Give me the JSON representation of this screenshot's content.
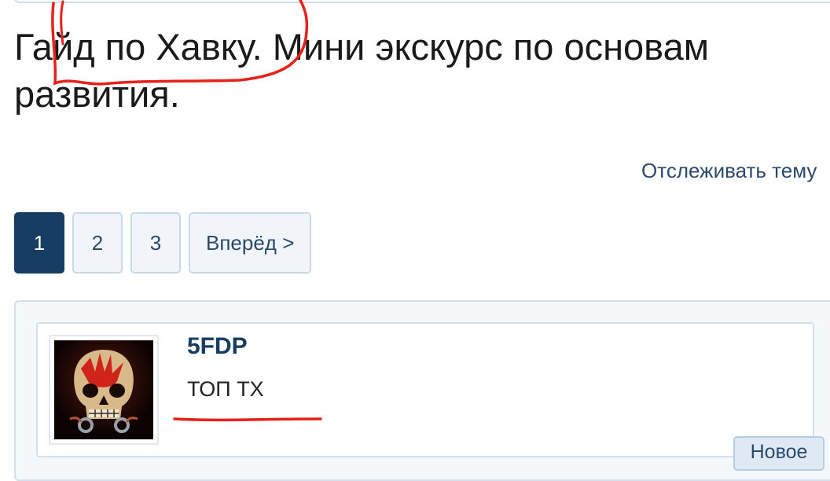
{
  "thread": {
    "title": "Гайд по Хавку. Мини экскурс по основам развития."
  },
  "actions": {
    "watch_label": "Отслеживать тему"
  },
  "pagination": {
    "pages": [
      "1",
      "2",
      "3"
    ],
    "current": "1",
    "next_label": "Вперёд >"
  },
  "post": {
    "author": "5FDP",
    "author_title": "ТОП ТХ",
    "badge": "Новое",
    "avatar_icon": "skull-avatar"
  },
  "colors": {
    "accent": "#183d63",
    "annotation": "#e8201a"
  }
}
